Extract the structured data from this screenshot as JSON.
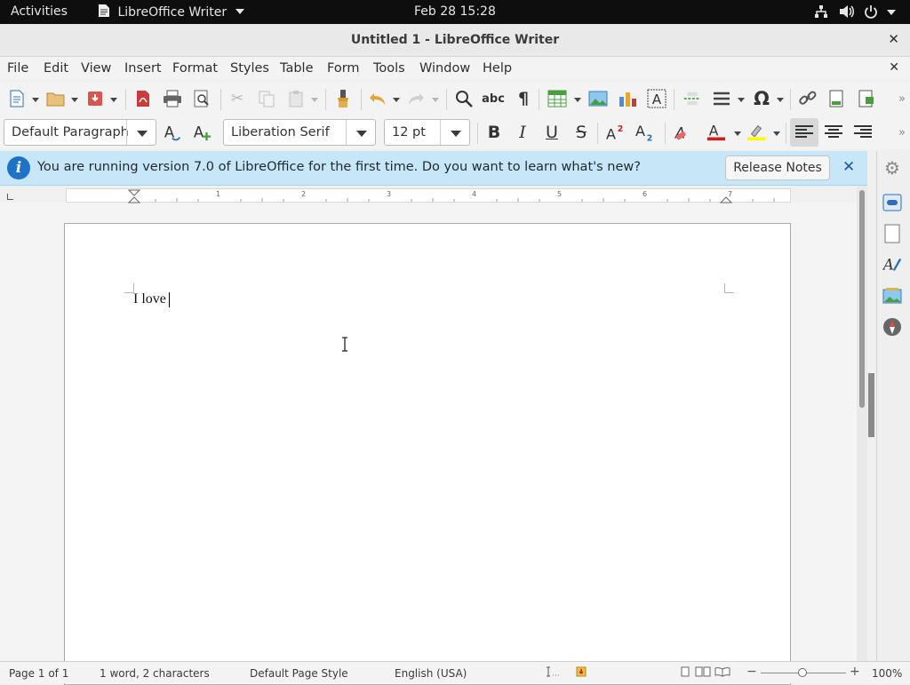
{
  "topbar": {
    "activities": "Activities",
    "app_name": "LibreOffice Writer",
    "clock": "Feb 28  15:28"
  },
  "window": {
    "title": "Untitled 1 - LibreOffice Writer"
  },
  "menu": {
    "items": [
      "File",
      "Edit",
      "View",
      "Insert",
      "Format",
      "Styles",
      "Table",
      "Form",
      "Tools",
      "Window",
      "Help"
    ]
  },
  "formatting": {
    "paragraph_style": "Default Paragraph",
    "font_name": "Liberation Serif",
    "font_size": "12 pt"
  },
  "infobar": {
    "message": "You are running version 7.0 of LibreOffice for the first time. Do you want to learn what's new?",
    "button": "Release Notes"
  },
  "document": {
    "text": "I love "
  },
  "statusbar": {
    "page": "Page 1 of 1",
    "words": "1 word, 2 characters",
    "page_style": "Default Page Style",
    "language": "English (USA)",
    "zoom": "100%"
  },
  "ruler": {
    "ticks": [
      "1",
      "2",
      "3",
      "4",
      "5",
      "6",
      "7"
    ]
  },
  "colors": {
    "font_color": "#c9211e",
    "highlight_color": "#ffff00",
    "infobar_bg": "#c7e6f7"
  }
}
